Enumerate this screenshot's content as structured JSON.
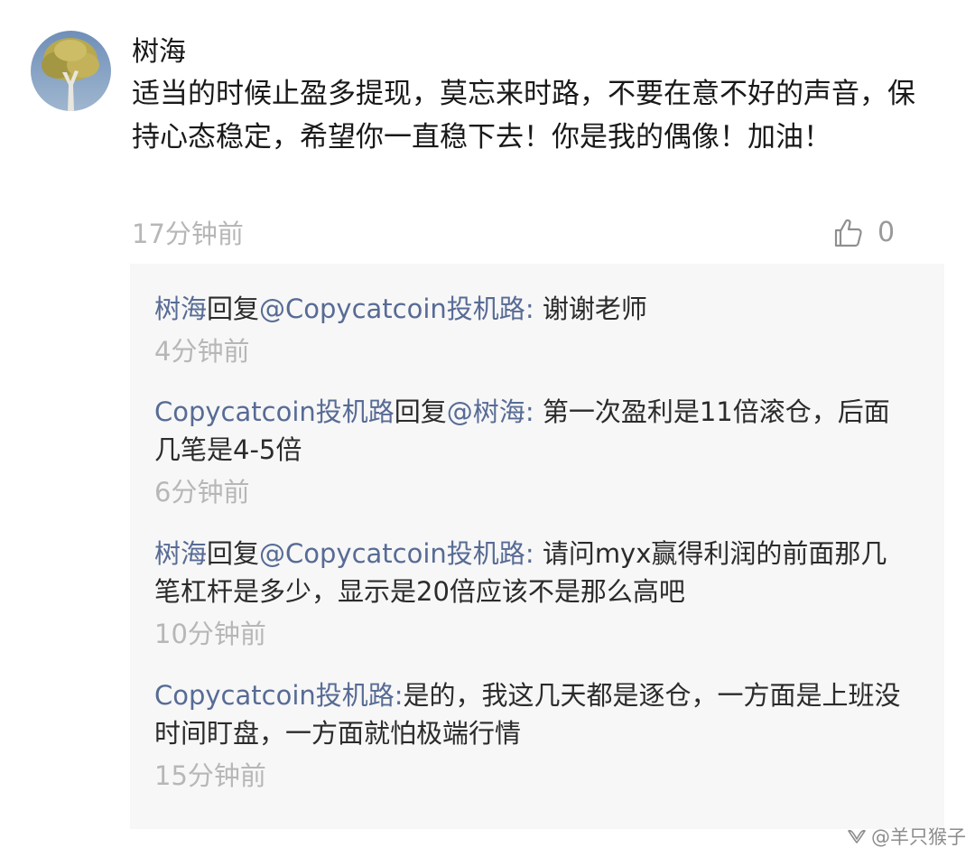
{
  "comment": {
    "author": "树海",
    "text": "适当的时候止盈多提现，莫忘来时路，不要在意不好的声音，保持心态稳定，希望你一直稳下去！你是我的偶像！加油！",
    "time": "17分钟前",
    "like_count": "0",
    "like_icon": "thumbs-up-icon",
    "avatar_icon": "tree-avatar"
  },
  "replies": [
    {
      "from": "树海",
      "reply_word": "回复",
      "to": "@Copycatcoin投机路",
      "separator": ": ",
      "text": "谢谢老师",
      "time": "4分钟前"
    },
    {
      "from": "Copycatcoin投机路",
      "reply_word": "回复",
      "to": "@树海",
      "separator": ": ",
      "text": "第一次盈利是11倍滚仓，后面几笔是4-5倍",
      "time": "6分钟前"
    },
    {
      "from": "树海",
      "reply_word": "回复",
      "to": "@Copycatcoin投机路",
      "separator": ": ",
      "text": "请问myx赢得利润的前面那几笔杠杆是多少，显示是20倍应该不是那么高吧",
      "time": "10分钟前"
    },
    {
      "from": "Copycatcoin投机路:",
      "text": "是的，我这几天都是逐仓，一方面是上班没时间盯盘，一方面就怕极端行情",
      "time": "15分钟前"
    }
  ],
  "watermark": {
    "text": "@羊只猴子",
    "icon": "wechat-channel-icon"
  },
  "colors": {
    "link": "#576b95",
    "muted": "#b7b7b7",
    "reply_bg": "#f7f7f7"
  }
}
